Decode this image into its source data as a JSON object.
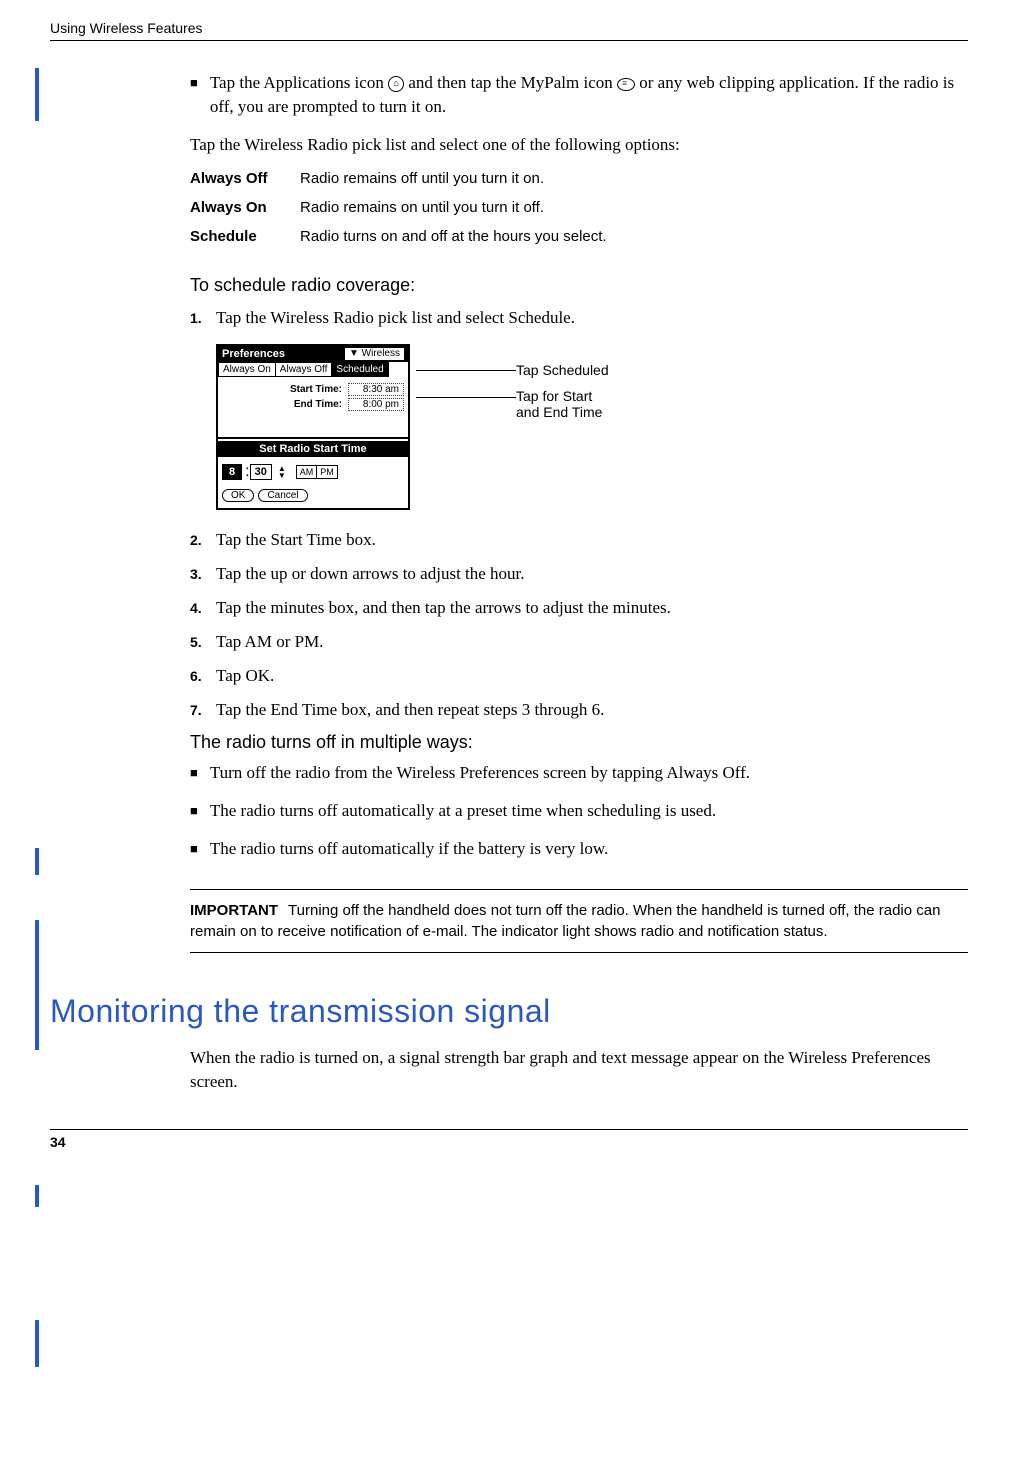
{
  "header": {
    "running_head": "Using Wireless Features"
  },
  "bullet_intro": "Tap the Applications icon     and then tap the MyPalm icon     or any web clipping application. If the radio is off, you are prompted to turn it on.",
  "bullet_intro_p1": "Tap the Applications icon ",
  "bullet_intro_p2": " and then tap the MyPalm icon ",
  "bullet_intro_p3": "  or any web clipping application. If the radio is off, you are prompted to turn it on.",
  "pick_para": "Tap the Wireless Radio pick list and select one of the following options:",
  "defs": [
    {
      "term": "Always Off",
      "desc": "Radio remains off until you turn it on."
    },
    {
      "term": "Always On",
      "desc": "Radio remains on until you turn it off."
    },
    {
      "term": "Schedule",
      "desc": "Radio turns on and off at the hours you select."
    }
  ],
  "sub1": "To schedule radio coverage:",
  "steps1": [
    {
      "n": "1.",
      "t": "Tap the Wireless Radio pick list and select Schedule."
    }
  ],
  "palm": {
    "title_left": "Preferences",
    "title_right": "▼ Wireless",
    "tabs": [
      "Always On",
      "Always Off",
      "Scheduled"
    ],
    "start_label": "Start Time:",
    "start_val": "8:30 am",
    "end_label": "End Time:",
    "end_val": "8:00 pm",
    "popup_title": "Set Radio Start Time",
    "hour": "8",
    "colon": ":",
    "min": "30",
    "am": "AM",
    "pm": "PM",
    "ok": "OK",
    "cancel": "Cancel"
  },
  "callout1": "Tap Scheduled",
  "callout2a": "Tap for Start",
  "callout2b": "and End Time",
  "steps2": [
    {
      "n": "2.",
      "t": "Tap the Start Time box."
    },
    {
      "n": "3.",
      "t": "Tap the up or down arrows to adjust the hour."
    },
    {
      "n": "4.",
      "t": "Tap the minutes box, and then tap the arrows to adjust the minutes."
    },
    {
      "n": "5.",
      "t": "Tap AM or PM."
    },
    {
      "n": "6.",
      "t": "Tap OK."
    },
    {
      "n": "7.",
      "t": "Tap the End Time box, and then repeat steps 3 through 6."
    }
  ],
  "sub2": "The radio turns off in multiple ways:",
  "bullets2": [
    "Turn off the radio from the Wireless Preferences screen by tapping Always Off.",
    "The radio turns off automatically at a preset time when scheduling is used.",
    "The radio turns off automatically if the battery is very low."
  ],
  "important_label": "IMPORTANT",
  "important_text": "Turning off the handheld does not turn off the radio. When the handheld is turned off, the radio can remain on to receive notification of e-mail. The indicator light shows radio and notification status.",
  "h1": "Monitoring the transmission signal",
  "h1_para": "When the radio is turned on, a signal strength bar graph and text message appear on the Wireless Preferences screen.",
  "page_number": "34"
}
